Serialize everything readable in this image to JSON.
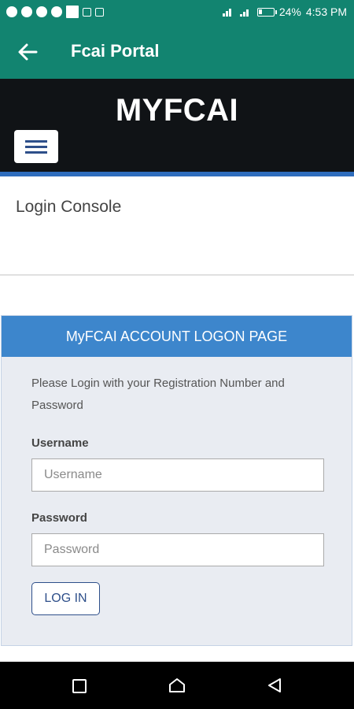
{
  "status_bar": {
    "battery": "24%",
    "time": "4:53 PM",
    "battery_level_percent": 24
  },
  "app_bar": {
    "title": "Fcai Portal",
    "back_icon": "arrow-left-icon"
  },
  "brand": {
    "title": "MYFCAI",
    "menu_icon": "hamburger-menu-icon"
  },
  "console": {
    "title": "Login Console"
  },
  "login_card": {
    "header": "MyFCAI ACCOUNT LOGON PAGE",
    "intro": "Please Login with your Registration Number and Password",
    "username_label": "Username",
    "username_placeholder": "Username",
    "username_value": "",
    "password_label": "Password",
    "password_placeholder": "Password",
    "password_value": "",
    "login_button": "LOG IN"
  },
  "colors": {
    "app_bar": "#128470",
    "brand_bg": "#101316",
    "card_header": "#3d86cc",
    "card_bg": "#e9ecf2",
    "button_text": "#2e4f8a"
  }
}
